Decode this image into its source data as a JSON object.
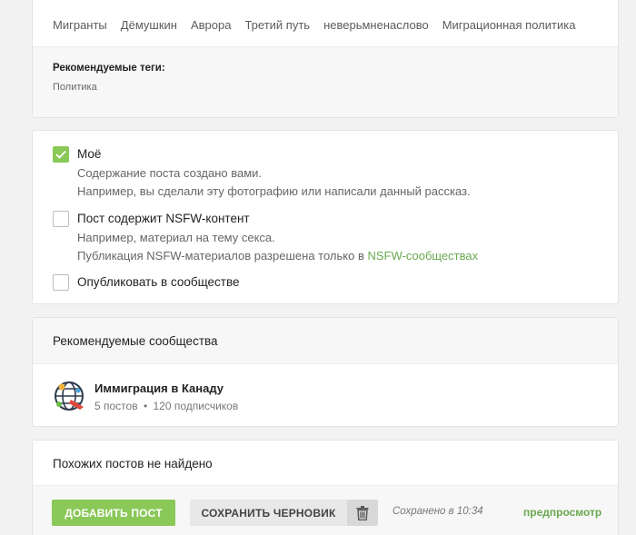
{
  "tags": {
    "items": [
      "Мигранты",
      "Дёмушкин",
      "Аврора",
      "Третий путь",
      "неверьмненаслово",
      "Миграционная политика"
    ],
    "recommended_title": "Рекомендуемые теги:",
    "recommended_items": [
      "Политика"
    ]
  },
  "options": {
    "mine": {
      "checked": true,
      "title": "Моё",
      "desc1": "Содержание поста создано вами.",
      "desc2": "Например, вы сделали эту фотографию или написали данный рассказ."
    },
    "nsfw": {
      "checked": false,
      "title": "Пост содержит NSFW-контент",
      "desc1": "Например, материал на тему секса.",
      "desc2_prefix": "Публикация NSFW-материалов разрешена только в ",
      "desc2_link": "NSFW-сообществах"
    },
    "community": {
      "checked": false,
      "title": "Опубликовать в сообществе"
    }
  },
  "communities": {
    "title": "Рекомендуемые сообщества",
    "items": [
      {
        "name": "Иммиграция в Канаду",
        "posts": "5 постов",
        "separator": "•",
        "subscribers": "120 подписчиков",
        "icon": "globe-avatar-icon"
      }
    ]
  },
  "similar": {
    "title": "Похожих постов не найдено"
  },
  "actions": {
    "add_post": "ДОБАВИТЬ ПОСТ",
    "save_draft": "СОХРАНИТЬ ЧЕРНОВИК",
    "delete_icon": "trash-icon",
    "saved_status": "Сохранено в 10:34",
    "preview": "предпросмотр"
  },
  "colors": {
    "accent_green": "#8ac858",
    "link_green": "#6aa84f",
    "background": "#f2f2f2"
  }
}
